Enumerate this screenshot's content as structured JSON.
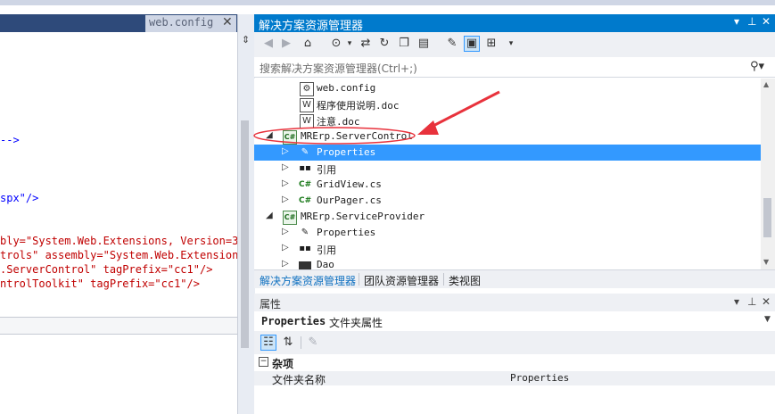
{
  "editor": {
    "tab_label": "web.config",
    "tab_close": "✕",
    "lines": [
      {
        "text": "-->",
        "color": "#0000ff"
      },
      {
        "text": "spx\"/>",
        "color": "#0000ff"
      },
      {
        "text": "bly=\"System.Web.Extensions, Version=3.",
        "color": "#c00000"
      },
      {
        "text": "trols\" assembly=\"System.Web.Extensions,",
        "color": "#c00000"
      },
      {
        "text": ".ServerControl\" tagPrefix=\"cc1\"/>",
        "color": "#c00000"
      },
      {
        "text": "ntrolToolkit\" tagPrefix=\"cc1\"/>",
        "color": "#c00000"
      }
    ]
  },
  "solution_explorer": {
    "title": "解决方案资源管理器",
    "title_buttons": [
      "▾",
      "⊥",
      "✕"
    ],
    "search_placeholder": "搜索解决方案资源管理器(Ctrl+;)",
    "search_icon": "search-icon",
    "toolbar_icons": [
      "back-icon",
      "forward-icon",
      "home-icon",
      "history-icon",
      "sync-icon",
      "refresh-icon",
      "collapse-all-icon",
      "show-all-files-icon",
      "properties-icon",
      "preview-icon",
      "class-diagram-icon",
      "dropdown-icon"
    ],
    "items": [
      {
        "label": "web.config",
        "icon": "config-icon"
      },
      {
        "label": "程序使用说明.doc",
        "icon": "word-doc-icon"
      },
      {
        "label": "注意.doc",
        "icon": "word-doc-icon"
      },
      {
        "label": "MRErp.ServerControl",
        "icon": "csharp-project-icon",
        "expanded": true
      },
      {
        "label": "Properties",
        "icon": "wrench-icon",
        "selected": true
      },
      {
        "label": "引用",
        "icon": "references-icon"
      },
      {
        "label": "GridView.cs",
        "icon": "csharp-file-icon"
      },
      {
        "label": "OurPager.cs",
        "icon": "csharp-file-icon"
      },
      {
        "label": "MRErp.ServiceProvider",
        "icon": "csharp-project-icon",
        "expanded": true
      },
      {
        "label": "Properties",
        "icon": "wrench-icon"
      },
      {
        "label": "引用",
        "icon": "references-icon"
      },
      {
        "label": "Dao",
        "icon": "folder-icon"
      }
    ],
    "tabs": [
      "解决方案资源管理器",
      "团队资源管理器",
      "类视图"
    ]
  },
  "properties": {
    "title": "属性",
    "title_buttons": [
      "▾",
      "⊥",
      "✕"
    ],
    "object_name": "Properties",
    "object_type": "文件夹属性",
    "category": "杂项",
    "rows": [
      {
        "name": "文件夹名称",
        "value": "Properties"
      }
    ]
  },
  "colors": {
    "accent": "#007acc",
    "selection": "#3399ff",
    "annotation": "#e8323c"
  }
}
